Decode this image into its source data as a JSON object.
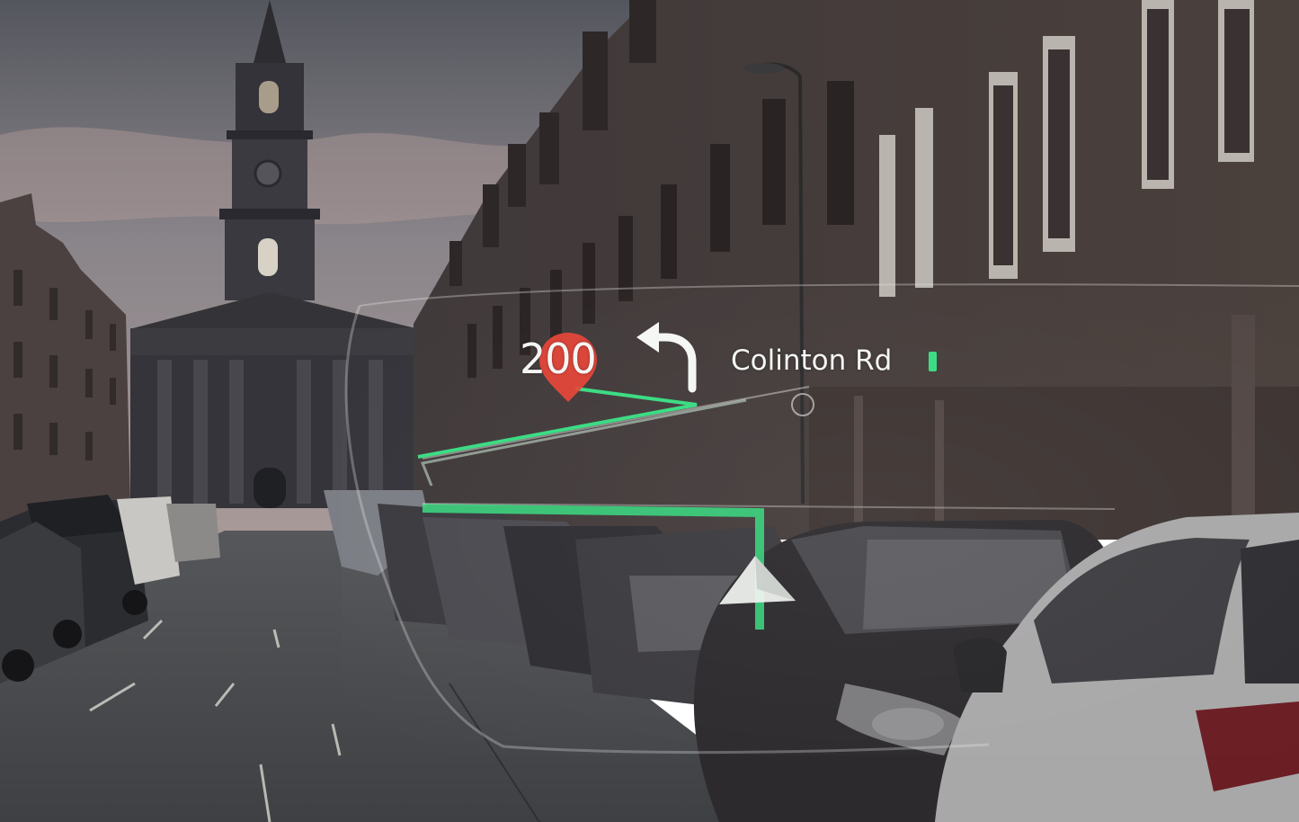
{
  "hud": {
    "distance": "200",
    "street": "Colinton Rd",
    "turn_direction": "left",
    "turn_icon": "turn-left-arrow-icon",
    "destination_icon": "map-pin-icon",
    "position_icon": "navigation-arrow-icon",
    "route_color": "#3ddc84",
    "pin_color": "#e8473b"
  }
}
